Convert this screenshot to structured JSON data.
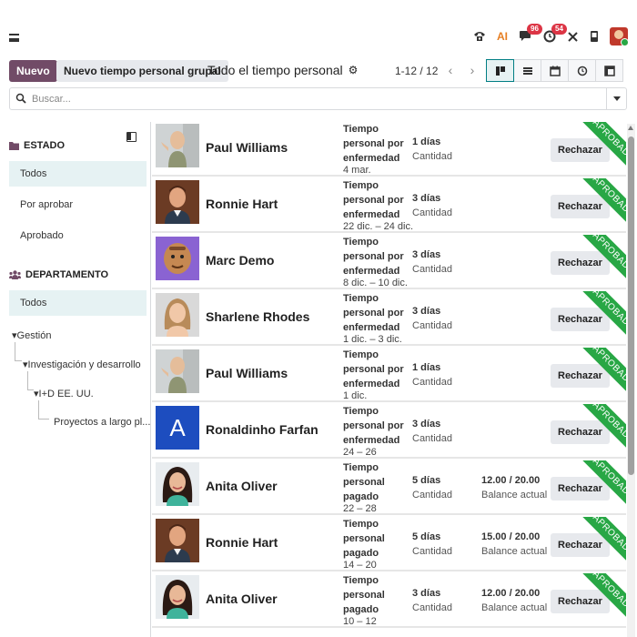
{
  "navbar": {
    "icons": [
      "menu-icon",
      "phone-icon",
      "ai-icon",
      "chat-icon",
      "activity-icon",
      "tools-icon",
      "device-icon",
      "user-avatar"
    ],
    "chat_badge": "96",
    "activity_badge": "54",
    "ai_label": "AI"
  },
  "control": {
    "new_label": "Nuevo",
    "new_group_label": "Nuevo tiempo personal grupal",
    "title": "Todo el tiempo personal",
    "pager": "1-12 / 12",
    "views": [
      "kanban",
      "list",
      "calendar",
      "activity",
      "pivot"
    ],
    "active_view": "kanban"
  },
  "search": {
    "placeholder": "Buscar..."
  },
  "sidepanel": {
    "estado_title": "ESTADO",
    "estado_items": [
      "Todos",
      "Por aprobar",
      "Aprobado"
    ],
    "departamento_title": "DEPARTAMENTO",
    "departamento_all": "Todos",
    "tree": [
      "Gestión",
      "Investigación y desarrollo",
      "I+D EE. UU.",
      "Proyectos a largo pl..."
    ]
  },
  "cards": [
    {
      "name": "Paul Williams",
      "type": "Tiempo personal por enfermedad",
      "dates": "4 mar.",
      "days": "1 días",
      "days_label": "Cantidad",
      "balance": "",
      "balance_label": "",
      "refuse": "Rechazar",
      "status": "APROBADO",
      "photo": "paul"
    },
    {
      "name": "Ronnie Hart",
      "type": "Tiempo personal por enfermedad",
      "dates": "22 dic. – 24 dic.",
      "days": "3 días",
      "days_label": "Cantidad",
      "balance": "",
      "balance_label": "",
      "refuse": "Rechazar",
      "status": "APROBADO",
      "photo": "ronnie"
    },
    {
      "name": "Marc Demo",
      "type": "Tiempo personal por enfermedad",
      "dates": "8 dic. – 10 dic.",
      "days": "3 días",
      "days_label": "Cantidad",
      "balance": "",
      "balance_label": "",
      "refuse": "Rechazar",
      "status": "APROBADO",
      "photo": "marc"
    },
    {
      "name": "Sharlene Rhodes",
      "type": "Tiempo personal por enfermedad",
      "dates": "1 dic. – 3 dic.",
      "days": "3 días",
      "days_label": "Cantidad",
      "balance": "",
      "balance_label": "",
      "refuse": "Rechazar",
      "status": "APROBADO",
      "photo": "sharlene"
    },
    {
      "name": "Paul Williams",
      "type": "Tiempo personal por enfermedad",
      "dates": "1 dic.",
      "days": "1 días",
      "days_label": "Cantidad",
      "balance": "",
      "balance_label": "",
      "refuse": "Rechazar",
      "status": "APROBADO",
      "photo": "paul"
    },
    {
      "name": "Ronaldinho Farfan",
      "type": "Tiempo personal por enfermedad",
      "dates": "24 – 26",
      "days": "3 días",
      "days_label": "Cantidad",
      "balance": "",
      "balance_label": "",
      "refuse": "Rechazar",
      "status": "APROBADO",
      "photo": "letter",
      "initial": "A"
    },
    {
      "name": "Anita Oliver",
      "type": "Tiempo personal pagado",
      "dates": "22 – 28",
      "days": "5 días",
      "days_label": "Cantidad",
      "balance": "12.00 / 20.00",
      "balance_label": "Balance actual",
      "refuse": "Rechazar",
      "status": "APROBADO",
      "photo": "anita"
    },
    {
      "name": "Ronnie Hart",
      "type": "Tiempo personal pagado",
      "dates": "14 – 20",
      "days": "5 días",
      "days_label": "Cantidad",
      "balance": "15.00 / 20.00",
      "balance_label": "Balance actual",
      "refuse": "Rechazar",
      "status": "APROBADO",
      "photo": "ronnie"
    },
    {
      "name": "Anita Oliver",
      "type": "Tiempo personal pagado",
      "dates": "10 – 12",
      "days": "3 días",
      "days_label": "Cantidad",
      "balance": "12.00 / 20.00",
      "balance_label": "Balance actual",
      "refuse": "Rechazar",
      "status": "APROBADO",
      "photo": "anita"
    }
  ],
  "colors": {
    "primary": "#714b67",
    "accent": "#017e84",
    "approved": "#28a745",
    "badge": "#dc3545"
  }
}
